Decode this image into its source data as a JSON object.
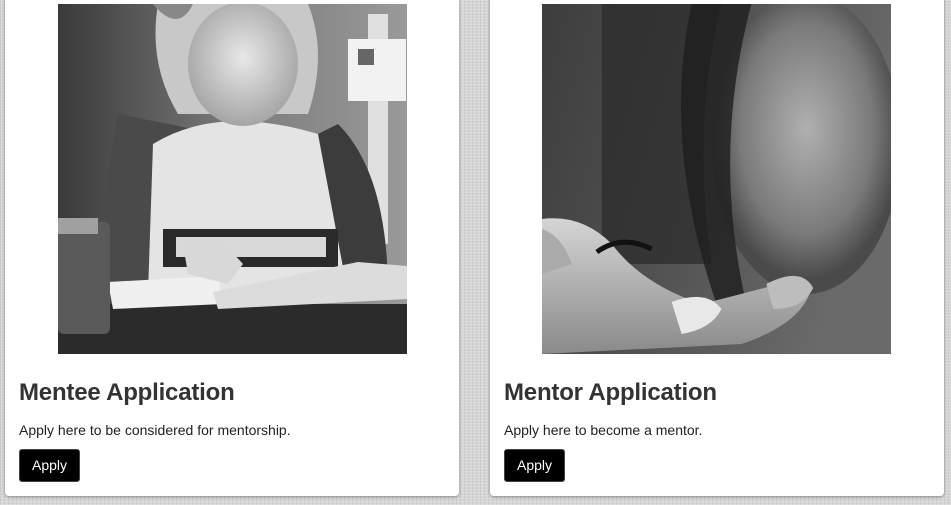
{
  "cards": [
    {
      "title": "Mentee Application",
      "description": "Apply here to be considered for mentorship.",
      "button_label": "Apply",
      "photo": "student-reading-photo"
    },
    {
      "title": "Mentor Application",
      "description": "Apply here to become a mentor.",
      "button_label": "Apply",
      "photo": "open-hand-photo"
    }
  ],
  "colors": {
    "button_bg": "#000000",
    "button_text": "#ffffff",
    "title_text": "#333333",
    "card_bg": "#ffffff",
    "page_bg": "#d6d6d6"
  }
}
